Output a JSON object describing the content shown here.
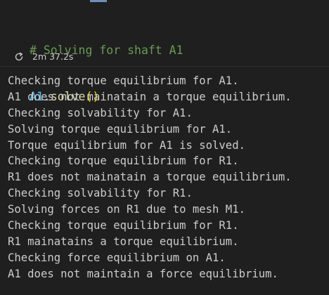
{
  "cell": {
    "code_lines": [
      {
        "comment": "# Solving for shaft A1"
      },
      {
        "var": "A1",
        "dot": ".",
        "func": "solve",
        "parens": "()"
      }
    ],
    "status": {
      "icon": "refresh-icon",
      "execution_time": "2m 37.2s"
    }
  },
  "output": {
    "lines": [
      "Checking torque equilibrium for A1.",
      "A1 does not mainatain a torque equilibrium.",
      "Checking solvability for A1.",
      "Solving torque equilibrium for A1.",
      "Torque equilibrium for A1 is solved.",
      "Checking torque equilibrium for R1.",
      "R1 does not mainatain a torque equilibrium.",
      "Checking solvability for R1.",
      "Solving forces on R1 due to mesh M1.",
      "Checking torque equilibrium for R1.",
      "R1 mainatains a torque equilibrium.",
      "Checking force equilibrium on A1.",
      "A1 does not maintain a force equilibrium."
    ]
  },
  "colors": {
    "background": "#1f1f1f",
    "comment": "#6a9955",
    "variable": "#4fc1ff",
    "function": "#dcdcaa",
    "parens": "#ffd700",
    "text": "#cccccc"
  }
}
